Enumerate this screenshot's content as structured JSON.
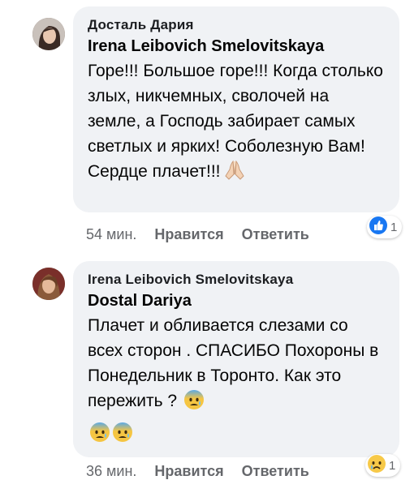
{
  "comments": [
    {
      "reply_to": "Досталь Дария",
      "author": "Irena Leibovich Smelovitskaya",
      "text": "Горе!!! Большое горе!!! Когда столько злых, никчемных, сволочей на земле, а Господь забирает самых светлых и ярких! Соболезную Вам! Сердце плачет!!!",
      "time": "54 мин.",
      "like_label": "Нравится",
      "reply_label": "Ответить",
      "reaction_count": "1",
      "reaction_icon": "like-icon"
    },
    {
      "reply_to": "Irena Leibovich Smelovitskaya",
      "author": "Dostal Dariya",
      "text": "Плачет и обливается слезами со всех сторон . СПАСИБО Похороны в Понедельник в Торонто. Как это пережить ?",
      "time": "36 мин.",
      "like_label": "Нравится",
      "reply_label": "Ответить",
      "reaction_count": "1",
      "reaction_icon": "sad-icon"
    }
  ]
}
